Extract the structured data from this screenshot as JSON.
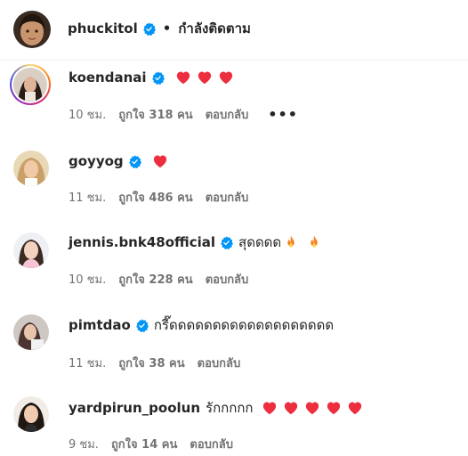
{
  "header": {
    "username": "phuckitol",
    "following_label": "กำลังติดตาม"
  },
  "comments": [
    {
      "username": "koendanai",
      "text": "",
      "hearts": 3,
      "fires": 0,
      "time": "10 ชม.",
      "likes": "ถูกใจ 318 คน",
      "reply": "ตอบกลับ",
      "more": "•••"
    },
    {
      "username": "goyyog",
      "text": "",
      "hearts": 1,
      "fires": 0,
      "time": "11 ชม.",
      "likes": "ถูกใจ 486 คน",
      "reply": "ตอบกลับ"
    },
    {
      "username": "jennis.bnk48official",
      "text": "สุดดดด",
      "hearts": 0,
      "fires": 2,
      "time": "10 ชม.",
      "likes": "ถูกใจ 228 คน",
      "reply": "ตอบกลับ"
    },
    {
      "username": "pimtdao",
      "text": "กรี๊ดดดดดดดดดดดดดดดดดดด",
      "hearts": 0,
      "fires": 0,
      "time": "11 ชม.",
      "likes": "ถูกใจ 38 คน",
      "reply": "ตอบกลับ"
    },
    {
      "username": "yardpirun_poolun",
      "text": "รักกกกก",
      "hearts": 5,
      "fires": 0,
      "time": "9 ชม.",
      "likes": "ถูกใจ 14 คน",
      "reply": "ตอบกลับ"
    }
  ],
  "colors": {
    "verified": "#0095f6",
    "heart": "#ed2e3f",
    "fire": "#f58220",
    "meta": "#737373"
  }
}
